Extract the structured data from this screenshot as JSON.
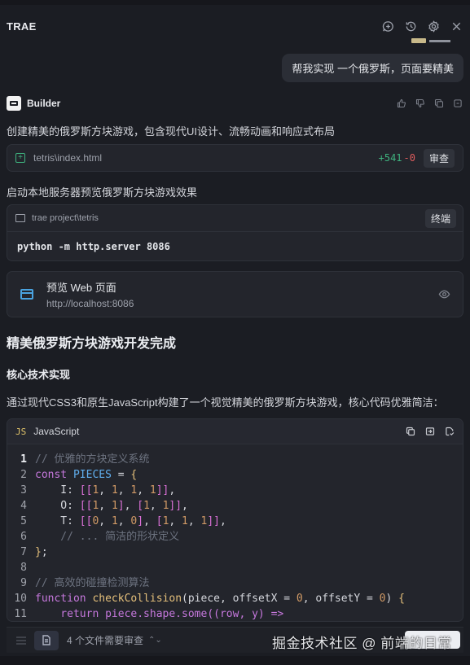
{
  "app": {
    "title": "TRAE"
  },
  "header_icons": [
    "add-chat-icon",
    "history-icon",
    "settings-icon",
    "close-icon"
  ],
  "user_message": "帮我实现 一个俄罗斯，页面要精美",
  "builder": {
    "name": "Builder",
    "feedback_icons": [
      "thumbs-up-icon",
      "thumbs-down-icon",
      "copy-icon",
      "restore-icon"
    ]
  },
  "messages": {
    "intro": "创建精美的俄罗斯方块游戏，包含现代UI设计、流畅动画和响应式布局",
    "serve_intro": "启动本地服务器预览俄罗斯方块游戏效果",
    "tech_intro": "通过现代CSS3和原生JavaScript构建了一个视觉精美的俄罗斯方块游戏，核心代码优雅简洁："
  },
  "file_change": {
    "path": "tetris\\index.html",
    "added": "+541",
    "removed": "-0",
    "review_label": "审查"
  },
  "terminal": {
    "cwd": "trae project\\tetris",
    "button_label": "终端",
    "command": "python -m http.server 8086"
  },
  "preview": {
    "title": "预览 Web 页面",
    "url": "http://localhost:8086"
  },
  "headings": {
    "done": "精美俄罗斯方块游戏开发完成",
    "tech": "核心技术实现"
  },
  "code": {
    "badge": "JS",
    "language": "JavaScript",
    "lines": [
      {
        "n": "1",
        "tokens": [
          {
            "t": "// 优雅的方块定义系统",
            "c": "c"
          }
        ]
      },
      {
        "n": "2",
        "tokens": [
          {
            "t": "const",
            "c": "k"
          },
          {
            "t": " ",
            "c": ""
          },
          {
            "t": "PIECES",
            "c": "v"
          },
          {
            "t": " = ",
            "c": ""
          },
          {
            "t": "{",
            "c": "p"
          }
        ]
      },
      {
        "n": "3",
        "tokens": [
          {
            "t": "    I: ",
            "c": ""
          },
          {
            "t": "[[",
            "c": "b"
          },
          {
            "t": "1",
            "c": "n"
          },
          {
            "t": ", ",
            "c": ""
          },
          {
            "t": "1",
            "c": "n"
          },
          {
            "t": ", ",
            "c": ""
          },
          {
            "t": "1",
            "c": "n"
          },
          {
            "t": ", ",
            "c": ""
          },
          {
            "t": "1",
            "c": "n"
          },
          {
            "t": "]]",
            "c": "b"
          },
          {
            "t": ",",
            "c": ""
          }
        ]
      },
      {
        "n": "4",
        "tokens": [
          {
            "t": "    O: ",
            "c": ""
          },
          {
            "t": "[[",
            "c": "b"
          },
          {
            "t": "1",
            "c": "n"
          },
          {
            "t": ", ",
            "c": ""
          },
          {
            "t": "1",
            "c": "n"
          },
          {
            "t": "]",
            "c": "b"
          },
          {
            "t": ", ",
            "c": ""
          },
          {
            "t": "[",
            "c": "b"
          },
          {
            "t": "1",
            "c": "n"
          },
          {
            "t": ", ",
            "c": ""
          },
          {
            "t": "1",
            "c": "n"
          },
          {
            "t": "]]",
            "c": "b"
          },
          {
            "t": ",",
            "c": ""
          }
        ]
      },
      {
        "n": "5",
        "tokens": [
          {
            "t": "    T: ",
            "c": ""
          },
          {
            "t": "[[",
            "c": "b"
          },
          {
            "t": "0",
            "c": "n"
          },
          {
            "t": ", ",
            "c": ""
          },
          {
            "t": "1",
            "c": "n"
          },
          {
            "t": ", ",
            "c": ""
          },
          {
            "t": "0",
            "c": "n"
          },
          {
            "t": "]",
            "c": "b"
          },
          {
            "t": ", ",
            "c": ""
          },
          {
            "t": "[",
            "c": "b"
          },
          {
            "t": "1",
            "c": "n"
          },
          {
            "t": ", ",
            "c": ""
          },
          {
            "t": "1",
            "c": "n"
          },
          {
            "t": ", ",
            "c": ""
          },
          {
            "t": "1",
            "c": "n"
          },
          {
            "t": "]]",
            "c": "b"
          },
          {
            "t": ",",
            "c": ""
          }
        ]
      },
      {
        "n": "6",
        "tokens": [
          {
            "t": "    // ... 简洁的形状定义",
            "c": "c"
          }
        ]
      },
      {
        "n": "7",
        "tokens": [
          {
            "t": "}",
            "c": "p"
          },
          {
            "t": ";",
            "c": ""
          }
        ]
      },
      {
        "n": "8",
        "tokens": []
      },
      {
        "n": "9",
        "tokens": [
          {
            "t": "// 高效的碰撞检测算法",
            "c": "c"
          }
        ]
      },
      {
        "n": "10",
        "tokens": [
          {
            "t": "function",
            "c": "k"
          },
          {
            "t": " ",
            "c": ""
          },
          {
            "t": "checkCollision",
            "c": "f"
          },
          {
            "t": "(piece, offsetX = ",
            "c": ""
          },
          {
            "t": "0",
            "c": "n"
          },
          {
            "t": ", offsetY = ",
            "c": ""
          },
          {
            "t": "0",
            "c": "n"
          },
          {
            "t": ") ",
            "c": ""
          },
          {
            "t": "{",
            "c": "p"
          }
        ]
      },
      {
        "n": "11",
        "tokens": [
          {
            "t": "    return piece.shape.some((row, y) =>",
            "c": "k"
          }
        ]
      }
    ],
    "toolbar_icons": [
      "copy-icon",
      "insert-icon",
      "apply-icon"
    ]
  },
  "bottom": {
    "review_count": "4 个文件需要审查"
  },
  "watermark": "掘金技术社区 @ 前端的日常"
}
